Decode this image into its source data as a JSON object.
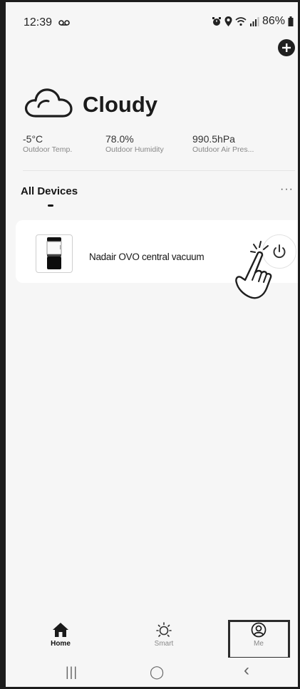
{
  "status_bar": {
    "time": "12:39",
    "battery": "86%",
    "icons": [
      "voicemail-icon",
      "alarm-icon",
      "location-icon",
      "wifi-icon",
      "signal-icon",
      "battery-icon"
    ]
  },
  "header": {
    "add_icon": "plus-circle-icon"
  },
  "weather": {
    "icon": "cloud-icon",
    "condition": "Cloudy",
    "metrics": [
      {
        "value": "-5°C",
        "label": "Outdoor Temp."
      },
      {
        "value": "78.0%",
        "label": "Outdoor Humidity"
      },
      {
        "value": "990.5hPa",
        "label": "Outdoor Air Pres..."
      }
    ]
  },
  "devices_section": {
    "title": "All Devices",
    "more_label": "···"
  },
  "devices": [
    {
      "name": "Nadair OVO central vacuum",
      "icon": "power-icon"
    }
  ],
  "tab_bar": {
    "tabs": [
      {
        "label": "Home",
        "icon": "home-icon",
        "selected": true
      },
      {
        "label": "Smart",
        "icon": "sun-icon",
        "selected": false
      },
      {
        "label": "Me",
        "icon": "user-icon",
        "selected": false
      }
    ]
  },
  "nav_bar": {
    "recents": "|||",
    "home": "◯",
    "back": "‹"
  },
  "colors": {
    "background": "#f6f6f6",
    "card": "#ffffff",
    "text": "#1b1b1b",
    "muted": "#888888"
  }
}
